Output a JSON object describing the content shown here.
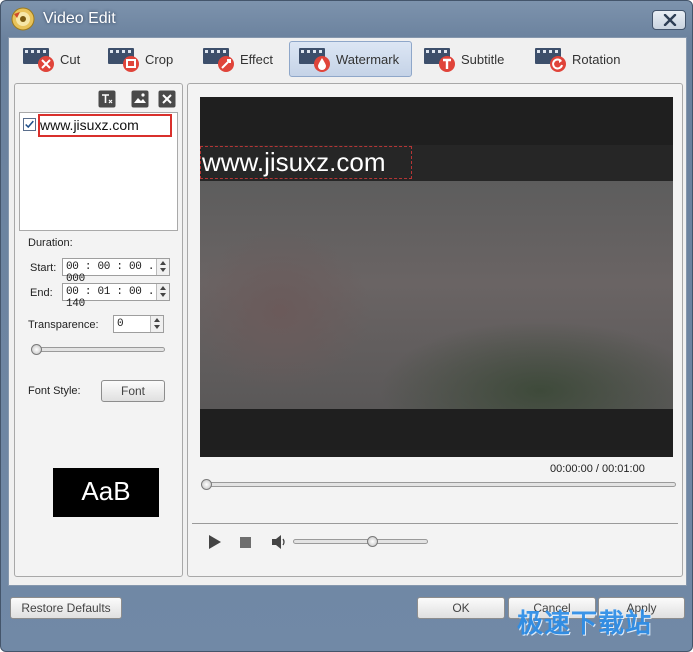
{
  "window": {
    "title": "Video Edit",
    "app_icon": "disc-icon",
    "close_icon": "close-icon"
  },
  "tabs": [
    {
      "label": "Cut",
      "icon": "film-scissors-icon",
      "active": false
    },
    {
      "label": "Crop",
      "icon": "film-crop-icon",
      "active": false
    },
    {
      "label": "Effect",
      "icon": "film-effect-icon",
      "active": false
    },
    {
      "label": "Watermark",
      "icon": "film-watermark-icon",
      "active": true
    },
    {
      "label": "Subtitle",
      "icon": "film-subtitle-icon",
      "active": false
    },
    {
      "label": "Rotation",
      "icon": "film-rotation-icon",
      "active": false
    }
  ],
  "watermark_panel": {
    "items": [
      {
        "text": "www.jisuxz.com",
        "checked": true
      }
    ],
    "duration_label": "Duration:",
    "start_label": "Start:",
    "start_value": "00 : 00 : 00 . 000",
    "end_label": "End:",
    "end_value": "00 : 01 : 00 . 140",
    "transparence_label": "Transparence:",
    "transparence_value": "0",
    "transparence_level": 0,
    "font_style_label": "Font Style:",
    "font_button": "Font",
    "font_preview": "AaB"
  },
  "preview": {
    "watermark_text": "www.jisuxz.com",
    "current_time": "00:00:00",
    "time_separator": "/",
    "total_time": "00:01:00",
    "seek_position": 0,
    "volume_level": 0.6
  },
  "footer": {
    "restore_defaults": "Restore Defaults",
    "ok": "OK",
    "cancel": "Cancel",
    "apply": "Apply"
  },
  "branding": {
    "site_logo_text": "极速下载站"
  },
  "colors": {
    "accent_blue": "#2d8ee8",
    "highlight_red": "#d9302c",
    "title_bar": "#7189a6"
  }
}
